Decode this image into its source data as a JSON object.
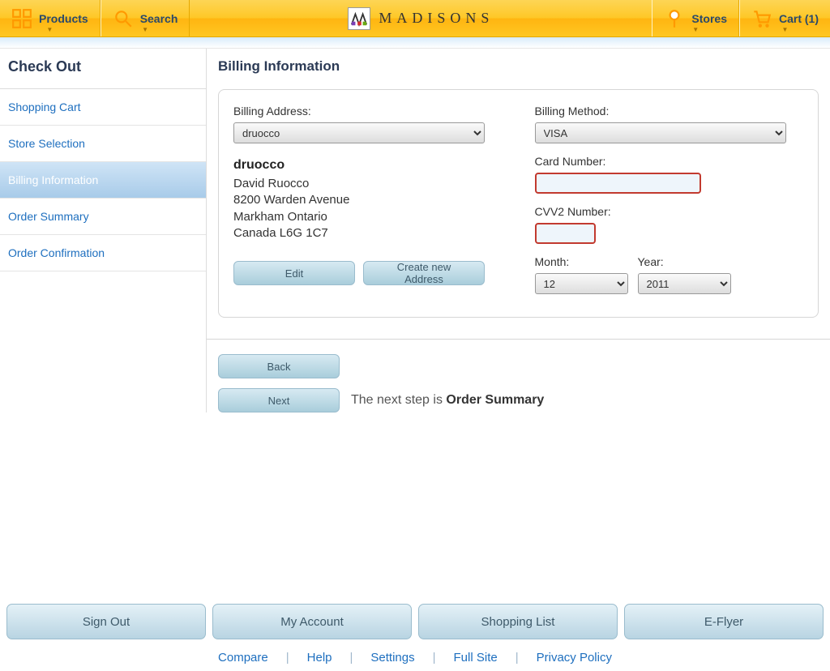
{
  "header": {
    "products": "Products",
    "search": "Search",
    "brand": "MADISONS",
    "stores": "Stores",
    "cart": "Cart (1)"
  },
  "sidebar": {
    "title": "Check Out",
    "items": [
      {
        "label": "Shopping Cart"
      },
      {
        "label": "Store Selection"
      },
      {
        "label": "Billing Information"
      },
      {
        "label": "Order Summary"
      },
      {
        "label": "Order Confirmation"
      }
    ]
  },
  "main": {
    "title": "Billing Information",
    "billing_address_label": "Billing Address:",
    "billing_address_value": "druocco",
    "address": {
      "name": "druocco",
      "line1": "David Ruocco",
      "line2": "8200 Warden Avenue",
      "line3": "Markham Ontario",
      "line4": "Canada L6G 1C7"
    },
    "edit_label": "Edit",
    "create_label": "Create new Address",
    "billing_method_label": "Billing Method:",
    "billing_method_value": "VISA",
    "card_number_label": "Card Number:",
    "cvv_label": "CVV2 Number:",
    "month_label": "Month:",
    "month_value": "12",
    "year_label": "Year:",
    "year_value": "2011",
    "back_label": "Back",
    "next_label": "Next",
    "next_hint_prefix": "The next step is ",
    "next_hint_strong": "Order Summary"
  },
  "footer": {
    "buttons": [
      "Sign Out",
      "My Account",
      "Shopping List",
      "E-Flyer"
    ],
    "links": [
      "Compare",
      "Help",
      "Settings",
      "Full Site",
      "Privacy Policy"
    ]
  }
}
